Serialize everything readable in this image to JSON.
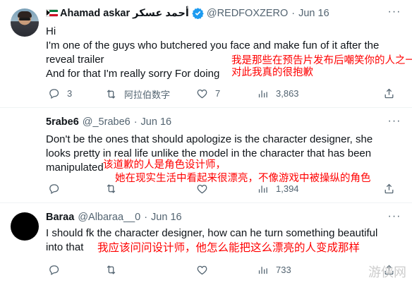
{
  "tweets": [
    {
      "author_name": "Ahamad askar أحمد عسكر",
      "handle": "@REDFOXZERO",
      "separator": "·",
      "date": "Jun 16",
      "lines": [
        "Hi",
        "I'm one of the guys who butchered you face and make fun of it  after the",
        "reveal trailer",
        "And for that I'm really sorry For doing"
      ],
      "annotation": [
        "我是那些在预告片发布后嘲笑你的人之一，",
        "对此我真的很抱歉"
      ],
      "actions": {
        "replies": "3",
        "retweets": "阿拉伯数字",
        "likes": "7",
        "views": "3,863"
      }
    },
    {
      "author_name": "5rabe6",
      "handle": "@_5rabe6",
      "separator": "·",
      "date": "Jun 16",
      "lines": [
        "Don't be the ones that should apologize is the character designer, she",
        "looks pretty in real life unlike the model in the character that has been",
        "manipulated"
      ],
      "annotation": [
        "该道歉的人是角色设计师，",
        "她在现实生活中看起来很漂亮，不像游戏中被操纵的角色"
      ],
      "actions": {
        "replies": "",
        "retweets": "",
        "likes": "",
        "views": "1,394"
      }
    },
    {
      "author_name": "Baraa",
      "handle": "@Albaraa__0",
      "separator": "·",
      "date": "Jun 16",
      "lines": [
        "I should fk the character designer, how can he turn something beautiful",
        "into that"
      ],
      "annotation": [
        "我应该问问设计师，他怎么能把这么漂亮的人变成那样"
      ],
      "actions": {
        "replies": "",
        "retweets": "",
        "likes": "",
        "views": "733"
      }
    }
  ],
  "icons": [
    "avatar",
    "kuwait-flag-icon",
    "verified-badge-icon",
    "more-icon",
    "reply-icon",
    "retweet-icon",
    "like-icon",
    "views-icon",
    "share-icon"
  ],
  "colors": {
    "verified": "#1d9bf0",
    "annotation": "#ff0000",
    "secondary": "#536471"
  },
  "watermark": "游侠网"
}
